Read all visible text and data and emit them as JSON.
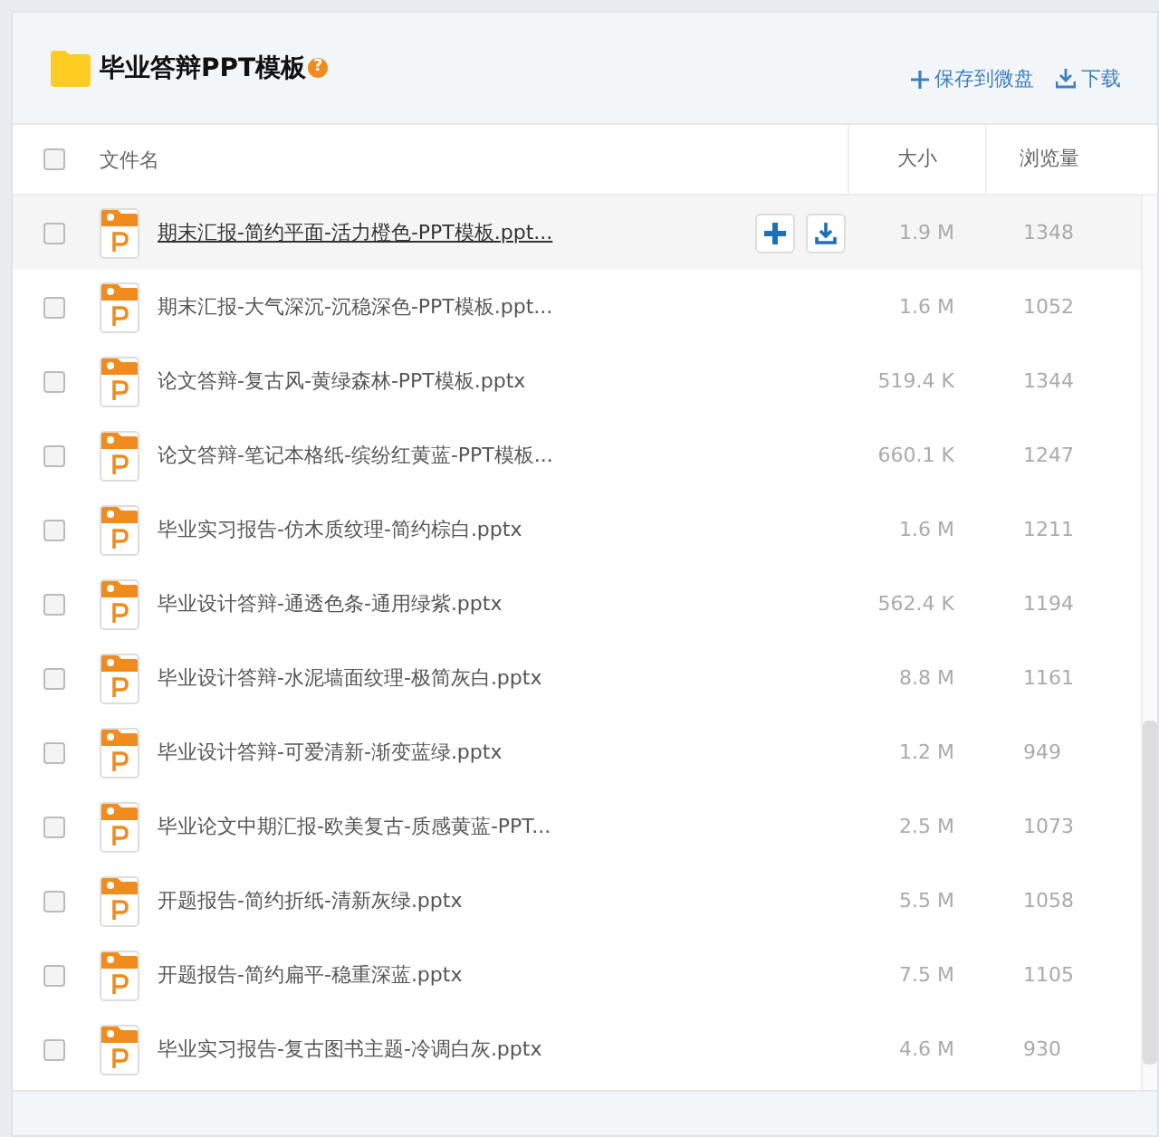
{
  "header": {
    "title": "毕业答辩PPT模板",
    "help_mark": "?",
    "actions": [
      {
        "kind": "save",
        "label": "保存到微盘"
      },
      {
        "kind": "download",
        "label": "下载"
      }
    ]
  },
  "table": {
    "columns": [
      "文件名",
      "大小",
      "浏览量"
    ],
    "select_all": {
      "checked": false
    },
    "rows": [
      {
        "name": "期末汇报-简约平面-活力橙色-PPT模板.ppt...",
        "size": "1.9 M",
        "views": "1348",
        "checked": false,
        "hovered": true
      },
      {
        "name": "期末汇报-大气深沉-沉稳深色-PPT模板.ppt...",
        "size": "1.6 M",
        "views": "1052",
        "checked": false,
        "hovered": false
      },
      {
        "name": "论文答辩-复古风-黄绿森林-PPT模板.pptx",
        "size": "519.4 K",
        "views": "1344",
        "checked": false,
        "hovered": false
      },
      {
        "name": "论文答辩-笔记本格纸-缤纷红黄蓝-PPT模板...",
        "size": "660.1 K",
        "views": "1247",
        "checked": false,
        "hovered": false
      },
      {
        "name": "毕业实习报告-仿木质纹理-简约棕白.pptx",
        "size": "1.6 M",
        "views": "1211",
        "checked": false,
        "hovered": false
      },
      {
        "name": "毕业设计答辩-通透色条-通用绿紫.pptx",
        "size": "562.4 K",
        "views": "1194",
        "checked": false,
        "hovered": false
      },
      {
        "name": "毕业设计答辩-水泥墙面纹理-极简灰白.pptx",
        "size": "8.8 M",
        "views": "1161",
        "checked": false,
        "hovered": false
      },
      {
        "name": "毕业设计答辩-可爱清新-渐变蓝绿.pptx",
        "size": "1.2 M",
        "views": "949",
        "checked": false,
        "hovered": false
      },
      {
        "name": "毕业论文中期汇报-欧美复古-质感黄蓝-PPT...",
        "size": "2.5 M",
        "views": "1073",
        "checked": false,
        "hovered": false
      },
      {
        "name": "开题报告-简约折纸-清新灰绿.pptx",
        "size": "5.5 M",
        "views": "1058",
        "checked": false,
        "hovered": false
      },
      {
        "name": "开题报告-简约扁平-稳重深蓝.pptx",
        "size": "7.5 M",
        "views": "1105",
        "checked": false,
        "hovered": false
      },
      {
        "name": "毕业实习报告-复古图书主题-冷调白灰.pptx",
        "size": "4.6 M",
        "views": "930",
        "checked": false,
        "hovered": false
      }
    ]
  }
}
